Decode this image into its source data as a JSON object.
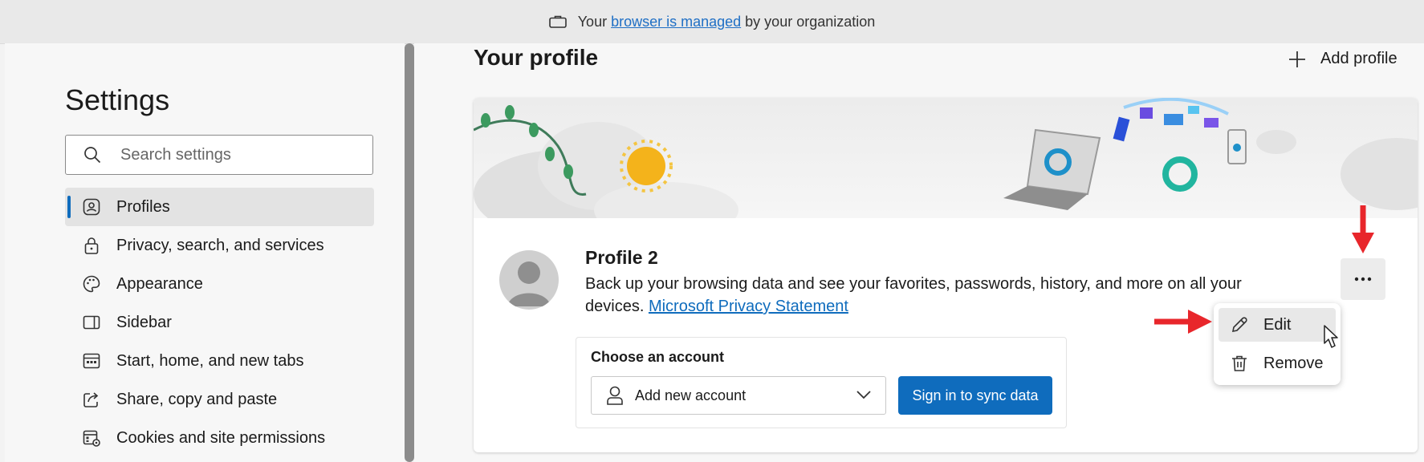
{
  "banner": {
    "prefix": "Your",
    "link": "browser is managed",
    "suffix": "by your organization"
  },
  "sidebar": {
    "title": "Settings",
    "search_placeholder": "Search settings",
    "items": [
      {
        "label": "Profiles",
        "icon": "profiles-icon",
        "active": true
      },
      {
        "label": "Privacy, search, and services",
        "icon": "lock-icon"
      },
      {
        "label": "Appearance",
        "icon": "palette-icon"
      },
      {
        "label": "Sidebar",
        "icon": "sidebar-icon"
      },
      {
        "label": "Start, home, and new tabs",
        "icon": "start-tabs-icon"
      },
      {
        "label": "Share, copy and paste",
        "icon": "share-icon"
      },
      {
        "label": "Cookies and site permissions",
        "icon": "cookies-settings-icon"
      }
    ]
  },
  "main": {
    "title": "Your profile",
    "add_profile": "Add profile",
    "profile": {
      "name": "Profile 2",
      "description": "Back up your browsing data and see your favorites, passwords, history, and more on all your devices.",
      "privacy_link": "Microsoft Privacy Statement"
    },
    "account": {
      "title": "Choose an account",
      "selected": "Add new account",
      "sync_button": "Sign in to sync data"
    },
    "menu": {
      "edit": "Edit",
      "remove": "Remove"
    }
  },
  "colors": {
    "accent": "#0f6cbd",
    "annotation": "#e8262b"
  }
}
